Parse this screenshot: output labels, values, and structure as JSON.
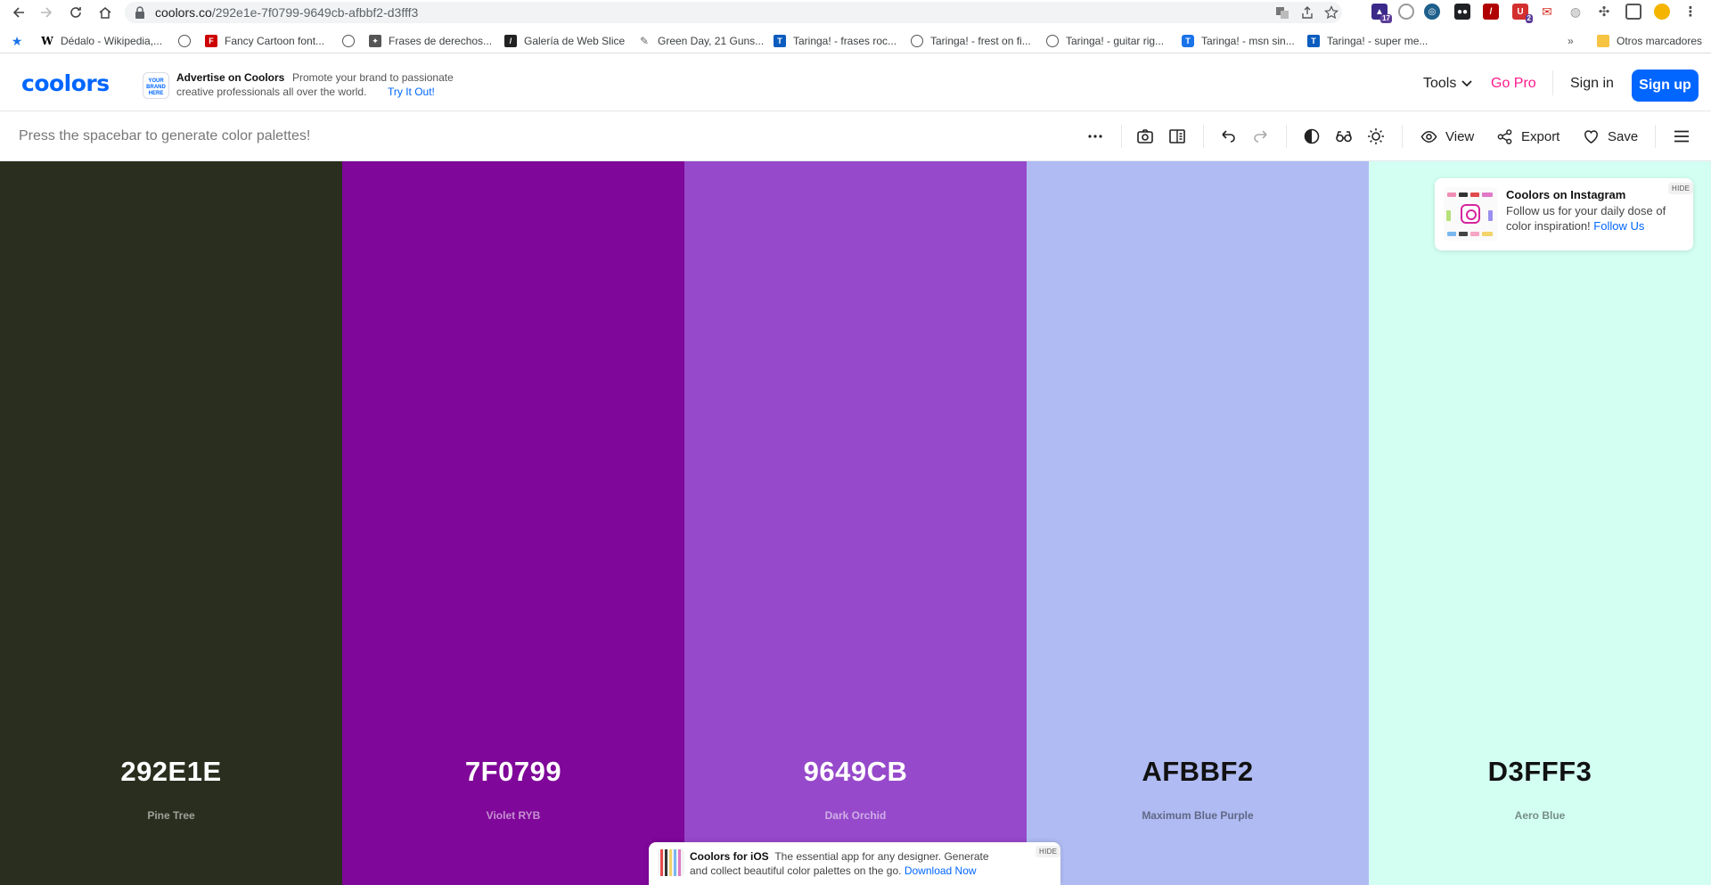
{
  "browser": {
    "url_host": "coolors.co",
    "url_path": "/292e1e-7f0799-9649cb-afbbf2-d3fff3",
    "extension_badges": [
      "17",
      "2"
    ],
    "bookmarks": [
      {
        "label": "Dédalo - Wikipedia,...",
        "icon": "wikipedia-icon",
        "color": "#ffffff"
      },
      {
        "label": "Fancy  Cartoon font...",
        "icon": "fancy-icon",
        "color": "#cc0000"
      },
      {
        "label": "Frases de derechos...",
        "icon": "frases-icon",
        "color": "#555555"
      },
      {
        "label": "Galería de Web Slice",
        "icon": "webslice-icon",
        "color": "#222222"
      },
      {
        "label": "Green Day, 21 Guns...",
        "icon": "greenday-icon",
        "color": "#666666"
      },
      {
        "label": "Taringa! - frases roc...",
        "icon": "taringa-icon",
        "color": "#0b5cbe"
      },
      {
        "label": "Taringa! - frest on fi...",
        "icon": "globe-icon",
        "color": "#666666"
      },
      {
        "label": "Taringa! - guitar rig...",
        "icon": "globe-icon",
        "color": "#666666"
      },
      {
        "label": "Taringa! - msn sin...",
        "icon": "taringa-icon",
        "color": "#1a73e8"
      },
      {
        "label": "Taringa! - super me...",
        "icon": "taringa-icon",
        "color": "#0b5cbe"
      }
    ],
    "other_bookmarks": "Otros marcadores"
  },
  "header": {
    "logo": "coolors",
    "ad_box_text": "YOUR BRAND HERE",
    "ad_title": "Advertise on Coolors",
    "ad_desc_line1": "Promote your brand to passionate",
    "ad_desc_line2": "creative professionals all over the world.",
    "ad_link": "Try It Out!",
    "tools": "Tools",
    "go_pro": "Go Pro",
    "sign_in": "Sign in",
    "sign_up": "Sign up"
  },
  "toolbar": {
    "hint": "Press the spacebar to generate color palettes!",
    "view": "View",
    "export": "Export",
    "save": "Save"
  },
  "palette": [
    {
      "hex": "292E1E",
      "name": "Pine Tree",
      "color": "#292e1e",
      "tone": "dark"
    },
    {
      "hex": "7F0799",
      "name": "Violet RYB",
      "color": "#7f0799",
      "tone": "dark"
    },
    {
      "hex": "9649CB",
      "name": "Dark Orchid",
      "color": "#9649cb",
      "tone": "dark"
    },
    {
      "hex": "AFBBF2",
      "name": "Maximum Blue Purple",
      "color": "#afbbf2",
      "tone": "light"
    },
    {
      "hex": "D3FFF3",
      "name": "Aero Blue",
      "color": "#d3fff3",
      "tone": "light"
    }
  ],
  "instagram_promo": {
    "title": "Coolors on Instagram",
    "desc": "Follow us for your daily dose of color inspiration!",
    "link": "Follow Us",
    "hide": "HIDE"
  },
  "ios_promo": {
    "title": "Coolors for iOS",
    "desc": "The essential app for any designer. Generate and collect beautiful color palettes on the go.",
    "link": "Download Now",
    "hide": "HIDE"
  },
  "colors": {
    "accent": "#0066ff",
    "pro": "#ff1a8c"
  }
}
